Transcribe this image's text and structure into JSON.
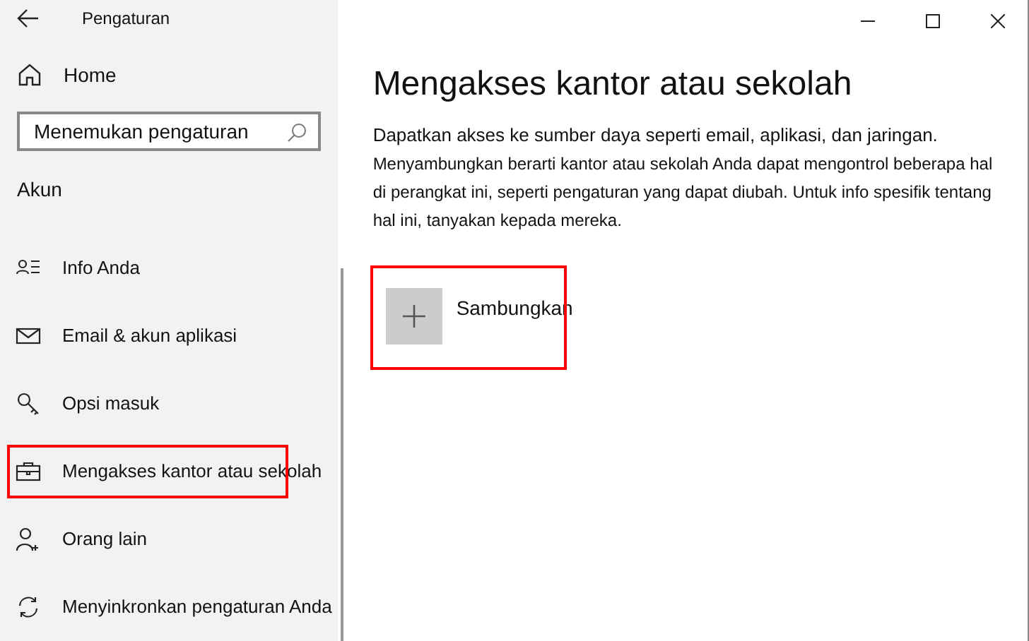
{
  "window": {
    "title": "Pengaturan"
  },
  "sidebar": {
    "home": "Home",
    "search": {
      "placeholder": "Menemukan pengaturan"
    },
    "section": "Akun",
    "items": [
      {
        "kind": "info",
        "label": "Info Anda",
        "highlighted": false
      },
      {
        "kind": "email",
        "label": "Email & akun aplikasi",
        "highlighted": false
      },
      {
        "kind": "key",
        "label": "Opsi masuk",
        "highlighted": false
      },
      {
        "kind": "work",
        "label": "Mengakses kantor atau sekolah",
        "highlighted": true
      },
      {
        "kind": "people",
        "label": "Orang lain",
        "highlighted": false
      },
      {
        "kind": "sync",
        "label": "Menyinkronkan pengaturan Anda",
        "highlighted": false
      }
    ]
  },
  "main": {
    "title": "Mengakses kantor atau sekolah",
    "paragraphs": [
      "Dapatkan akses ke sumber daya seperti email, aplikasi, dan jaringan.",
      "Menyambungkan berarti kantor atau sekolah Anda dapat mengontrol beberapa hal di perangkat ini, seperti pengaturan yang dapat diubah. Untuk info spesifik tentang hal ini, tanyakan kepada mereka."
    ],
    "connect": {
      "label": "Sambungkan",
      "highlighted": true
    }
  }
}
